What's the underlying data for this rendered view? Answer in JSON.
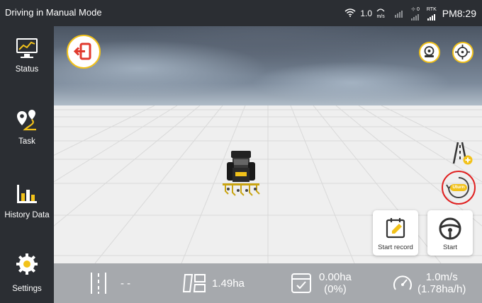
{
  "status_bar": {
    "mode": "Driving in Manual Mode",
    "speed_value": "1.0",
    "speed_unit": "m/s",
    "sat_count": "0",
    "rtk_label": "RTK",
    "time": "PM8:29"
  },
  "sidebar": {
    "items": [
      {
        "label": "Status",
        "icon": "monitor-chart-icon"
      },
      {
        "label": "Task",
        "icon": "route-pins-icon"
      },
      {
        "label": "History Data",
        "icon": "bar-chart-icon"
      },
      {
        "label": "Settings",
        "icon": "gear-icon"
      }
    ]
  },
  "viewport": {
    "buttons": {
      "exit": "exit-icon",
      "camera": "camera-icon",
      "locate": "target-icon",
      "guideline": "guideline-add-icon",
      "uturn_label": "Uturn",
      "start_record": "Start record",
      "start": "Start"
    }
  },
  "info_bar": {
    "swath": "- -",
    "area_total": "1.49ha",
    "area_done": "0.00ha",
    "area_pct": "(0%)",
    "speed": "1.0m/s",
    "rate": "(1.78ha/h)"
  },
  "colors": {
    "accent": "#f2c21a",
    "sidebar_bg": "#2b2e33",
    "infobar_bg": "#a6a9ad",
    "highlight_ring": "#e02020"
  }
}
